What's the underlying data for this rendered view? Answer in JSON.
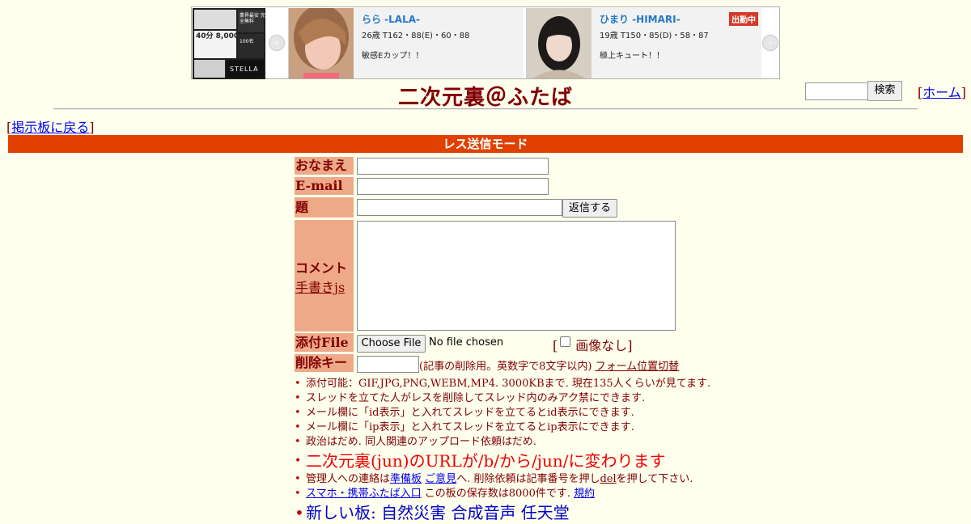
{
  "banner": {
    "poster": {
      "price1": "40分 8,000円",
      "text": "業界最安 完全無料",
      "stella": "STELLA",
      "hundred": "100名"
    },
    "cards": [
      {
        "name": "らら -LALA-",
        "stats": "26歳 T162・88(E)・60・88",
        "catchphrase": "敏感Eカップ！！",
        "badge": ""
      },
      {
        "name": "ひまり -HIMARI-",
        "stats": "19歳 T150・85(D)・58・87",
        "catchphrase": "極上キュート！！",
        "badge": "出勤中"
      }
    ],
    "prev_arrow": "‹",
    "next_arrow": "›"
  },
  "header": {
    "title": "二次元裏＠ふたば",
    "search_button": "検索",
    "home_open": "[",
    "home_label": "ホーム",
    "home_close": "]"
  },
  "nav": {
    "back_open": "[",
    "back_label": "掲示板に戻る",
    "back_close": "]"
  },
  "mode_bar": "レス送信モード",
  "form": {
    "name_label": "おなまえ",
    "email_label": "E-mail",
    "subject_label": "題名",
    "submit_label": "返信する",
    "comment_label": "コメント",
    "handwriting_link": "手書きjs",
    "file_label": "添付File",
    "file_button": "Choose File",
    "file_status": "No file chosen",
    "noimage_open": "[",
    "noimage_label": "画像なし",
    "noimage_close": "]",
    "delkey_label": "削除キー",
    "delkey_note": "(記事の削除用。英数字で8文字以内)",
    "form_position_link": "フォーム位置切替"
  },
  "rules": {
    "r1": "添付可能：GIF,JPG,PNG,WEBM,MP4. 3000KBまで. 現在135人くらいが見てます.",
    "r2": "スレッドを立てた人がレスを削除してスレッド内のみアク禁にできます.",
    "r3": "メール欄に「id表示」と入れてスレッドを立てるとid表示にできます.",
    "r4": "メール欄に「ip表示」と入れてスレッドを立てるとip表示にできます.",
    "r5": "政治はだめ. 同人関連のアップロード依頼はだめ.",
    "announcement": "二次元裏(jun)のURLが/b/から/jun/に変わります",
    "contact_prefix": "管理人への連絡は",
    "contact_link1": "準備板",
    "contact_link2": "ご意見",
    "contact_middle": "へ. 削除依頼は記事番号を押し",
    "contact_del": "del",
    "contact_suffix": "を押して下さい.",
    "mobile_link": "スマホ・携帯ふたば入口",
    "storage_text": "この板の保存数は8000件です.",
    "rules_link": "規約",
    "new_boards": "新しい板: 自然災害 合成音声 任天堂"
  }
}
